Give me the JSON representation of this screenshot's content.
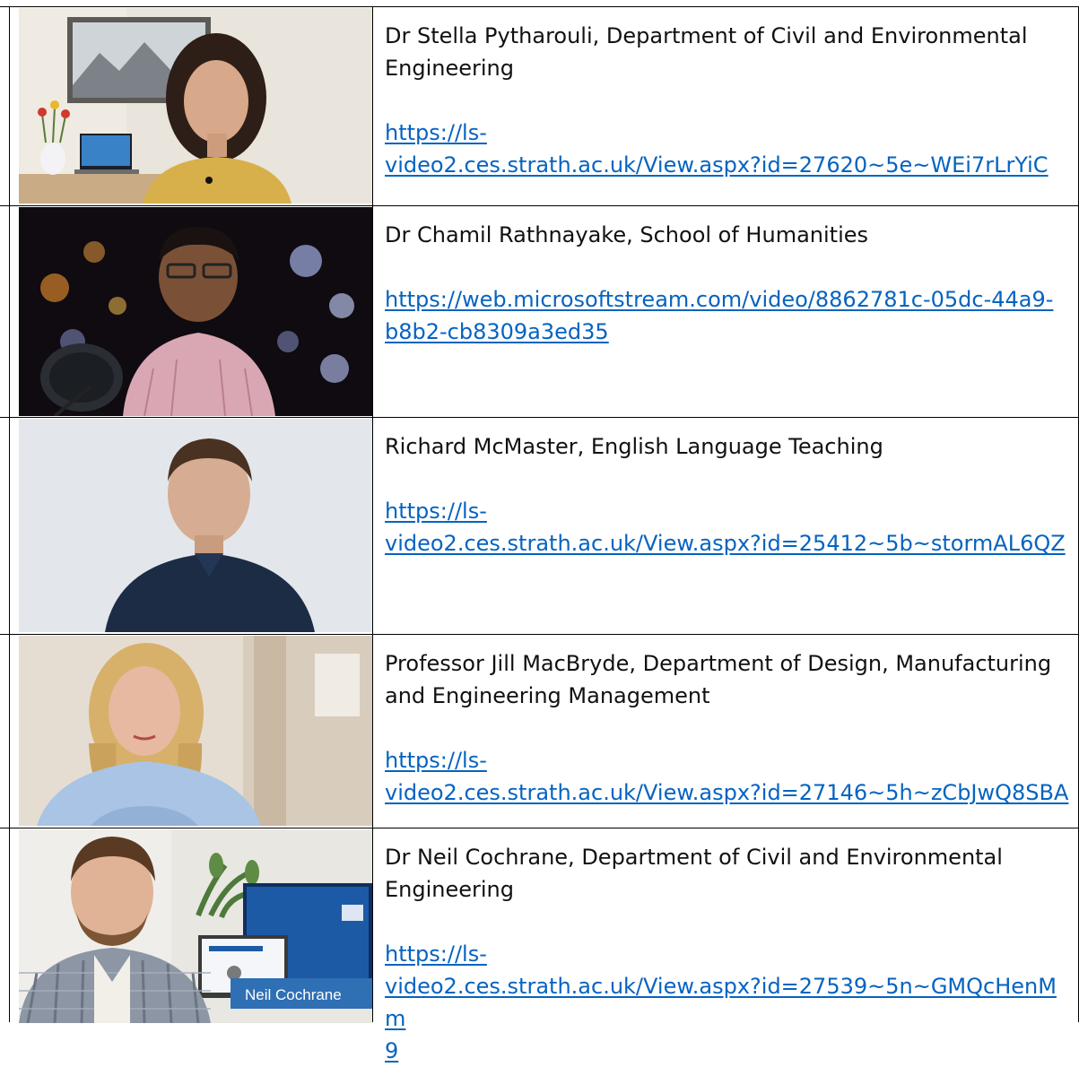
{
  "entries": [
    {
      "name": "Dr Stella Pytharouli, Department of Civil and Environmental Engineering",
      "name_lines": [
        "Dr Stella Pytharouli, Department of Civil and Environmental",
        "Engineering"
      ],
      "link_lines": [
        "https://ls-",
        "video2.ces.strath.ac.uk/View.aspx?id=27620~5e~WEi7rLrYiC"
      ]
    },
    {
      "name": "Dr Chamil Rathnayake, School of Humanities",
      "name_lines": [
        "Dr Chamil Rathnayake, School of Humanities"
      ],
      "link_lines": [
        "https://web.microsoftstream.com/video/8862781c-05dc-44a9-",
        "b8b2-cb8309a3ed35"
      ]
    },
    {
      "name": "Richard McMaster, English Language Teaching",
      "name_lines": [
        "Richard McMaster, English Language Teaching"
      ],
      "link_lines": [
        "https://ls-",
        "video2.ces.strath.ac.uk/View.aspx?id=25412~5b~stormAL6QZ"
      ]
    },
    {
      "name": "Professor Jill MacBryde, Department of Design, Manufacturing and Engineering Management",
      "name_lines": [
        "Professor Jill MacBryde, Department of Design, Manufacturing",
        "and Engineering Management"
      ],
      "link_lines": [
        "https://ls-",
        "video2.ces.strath.ac.uk/View.aspx?id=27146~5h~zCbJwQ8SBA"
      ]
    },
    {
      "name": "Dr Neil Cochrane, Department of Civil and Environmental Engineering",
      "name_lines": [
        "Dr Neil Cochrane, Department of Civil and Environmental",
        "Engineering"
      ],
      "link_lines": [
        "https://ls-",
        "video2.ces.strath.ac.uk/View.aspx?id=27539~5n~GMQcHenMm",
        "9"
      ],
      "caption": "Neil Cochrane"
    }
  ],
  "colors": {
    "link": "#0563c1",
    "border": "#000000",
    "text": "#111111"
  }
}
